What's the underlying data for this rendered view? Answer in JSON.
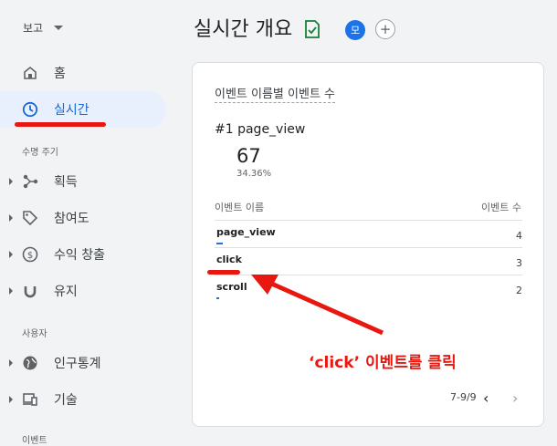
{
  "sidebar": {
    "report_label": "보고",
    "home_label": "홈",
    "realtime_label": "실시간",
    "lifecycle_header": "수명 주기",
    "items": [
      {
        "label": "획득"
      },
      {
        "label": "참여도"
      },
      {
        "label": "수익 창출"
      },
      {
        "label": "유지"
      }
    ],
    "user_header": "사용자",
    "user_items": [
      {
        "label": "인구통계"
      },
      {
        "label": "기술"
      }
    ],
    "bottom_header": "이벤트"
  },
  "header": {
    "title": "실시간 개요",
    "avatar_letter": "모",
    "add_symbol": "+"
  },
  "card": {
    "title": "이벤트 이름별 이벤트 수",
    "rank": "#1",
    "top_event": "page_view",
    "top_value": "67",
    "top_pct": "34.36%",
    "col_name": "이벤트 이름",
    "col_count": "이벤트 수",
    "rows": [
      {
        "name": "page_view",
        "count": "4",
        "bar_fraction": 0.02
      },
      {
        "name": "click",
        "count": "3",
        "bar_fraction": 0.015
      },
      {
        "name": "scroll",
        "count": "2",
        "bar_fraction": 0.01
      }
    ],
    "pagination": "7-9/9"
  },
  "annotation": {
    "text": "‘click’ 이벤트를 클릭",
    "color": "#e8170f"
  },
  "colors": {
    "accent": "#1a73e8",
    "active_bg": "#e8f0fe",
    "active_text": "#1967d2",
    "annotation_red": "#e8170f"
  }
}
